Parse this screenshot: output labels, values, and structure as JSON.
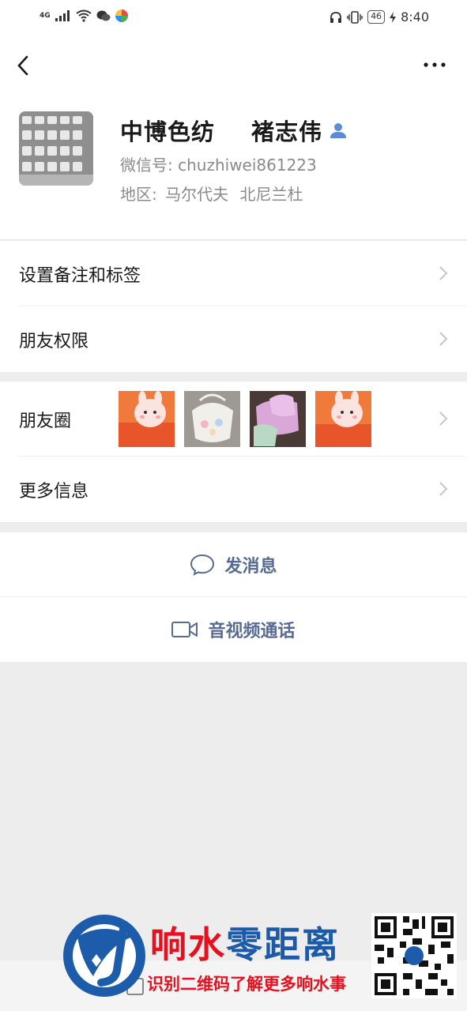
{
  "status_bar": {
    "signal": "4G",
    "battery": "46",
    "time": "8:40"
  },
  "nav": {
    "back_icon": "chevron-left-icon",
    "more_icon": "more-icon"
  },
  "profile": {
    "display_name": "中博色纺",
    "real_name": "褚志伟",
    "wechat_id_label": "微信号:",
    "wechat_id": "chuzhiwei861223",
    "region_label": "地区:",
    "region_country": "马尔代夫",
    "region_area": "北尼兰杜"
  },
  "menu": {
    "remark_tags": "设置备注和标签",
    "friend_permissions": "朋友权限",
    "moments": "朋友圈",
    "more_info": "更多信息"
  },
  "actions": {
    "send_message": "发消息",
    "av_call": "音视频通话"
  },
  "watermark": {
    "title_part1": "响水",
    "title_part2": "零距离",
    "subtitle": "识别二维码了解更多响水事"
  },
  "colors": {
    "link_blue": "#576b95",
    "watermark_red": "#e8101e",
    "watermark_blue": "#1a5aa8"
  }
}
